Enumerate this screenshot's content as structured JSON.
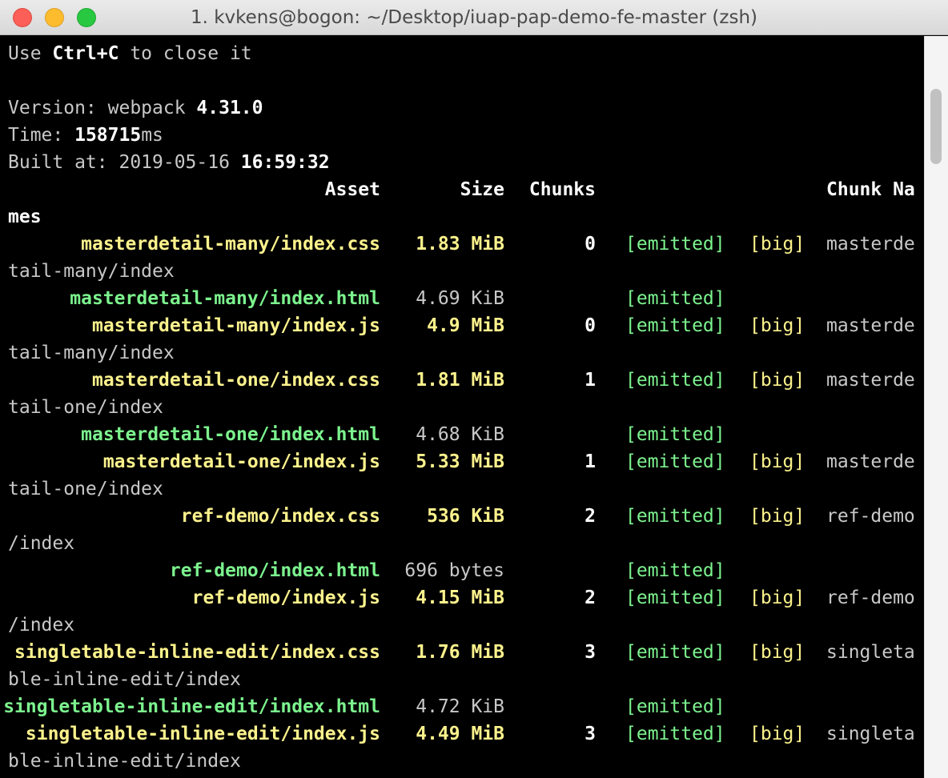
{
  "window": {
    "title": "1. kvkens@bogon: ~/Desktop/iuap-pap-demo-fe-master (zsh)"
  },
  "header": {
    "use_prefix": "Use ",
    "use_key": "Ctrl+C",
    "use_suffix": " to close it",
    "version_label": "Version: webpack ",
    "version_value": "4.31.0",
    "time_label": "Time: ",
    "time_value": "158715",
    "time_unit": "ms",
    "built_label": "Built at: 2019-05-16 ",
    "built_time": "16:59:32"
  },
  "columns": {
    "asset": "Asset",
    "size": "Size",
    "chunks": "Chunks",
    "chunk_names_a": "Chunk Na",
    "chunk_names_b": "mes"
  },
  "rows": [
    {
      "asset": "masterdetail-many/index.css",
      "size": "1.83 MiB",
      "chunk": "0",
      "emitted": "[emitted]",
      "big": "[big]",
      "name_a": "masterde",
      "name_b": "tail-many/index",
      "color": "#fcf28c"
    },
    {
      "asset": "masterdetail-many/index.html",
      "size": "4.69 KiB",
      "chunk": "",
      "emitted": "[emitted]",
      "big": "",
      "name_a": "",
      "name_b": "",
      "color": "#7cf38e"
    },
    {
      "asset": "masterdetail-many/index.js",
      "size": "4.9 MiB",
      "chunk": "0",
      "emitted": "[emitted]",
      "big": "[big]",
      "name_a": "masterde",
      "name_b": "tail-many/index",
      "color": "#fcf28c"
    },
    {
      "asset": "masterdetail-one/index.css",
      "size": "1.81 MiB",
      "chunk": "1",
      "emitted": "[emitted]",
      "big": "[big]",
      "name_a": "masterde",
      "name_b": "tail-one/index",
      "color": "#fcf28c"
    },
    {
      "asset": "masterdetail-one/index.html",
      "size": "4.68 KiB",
      "chunk": "",
      "emitted": "[emitted]",
      "big": "",
      "name_a": "",
      "name_b": "",
      "color": "#7cf38e"
    },
    {
      "asset": "masterdetail-one/index.js",
      "size": "5.33 MiB",
      "chunk": "1",
      "emitted": "[emitted]",
      "big": "[big]",
      "name_a": "masterde",
      "name_b": "tail-one/index",
      "color": "#fcf28c"
    },
    {
      "asset": "ref-demo/index.css",
      "size": "536 KiB",
      "chunk": "2",
      "emitted": "[emitted]",
      "big": "[big]",
      "name_a": "ref-demo",
      "name_b": "/index",
      "color": "#fcf28c"
    },
    {
      "asset": "ref-demo/index.html",
      "size": "696 bytes",
      "chunk": "",
      "emitted": "[emitted]",
      "big": "",
      "name_a": "",
      "name_b": "",
      "color": "#7cf38e"
    },
    {
      "asset": "ref-demo/index.js",
      "size": "4.15 MiB",
      "chunk": "2",
      "emitted": "[emitted]",
      "big": "[big]",
      "name_a": "ref-demo",
      "name_b": "/index",
      "color": "#fcf28c"
    },
    {
      "asset": "singletable-inline-edit/index.css",
      "size": "1.76 MiB",
      "chunk": "3",
      "emitted": "[emitted]",
      "big": "[big]",
      "name_a": "singleta",
      "name_b": "ble-inline-edit/index",
      "color": "#fcf28c"
    },
    {
      "asset": "singletable-inline-edit/index.html",
      "size": "4.72 KiB",
      "chunk": "",
      "emitted": "[emitted]",
      "big": "",
      "name_a": "",
      "name_b": "",
      "color": "#7cf38e"
    },
    {
      "asset": "singletable-inline-edit/index.js",
      "size": "4.49 MiB",
      "chunk": "3",
      "emitted": "[emitted]",
      "big": "[big]",
      "name_a": "singleta",
      "name_b": "ble-inline-edit/index",
      "color": "#fcf28c"
    }
  ]
}
